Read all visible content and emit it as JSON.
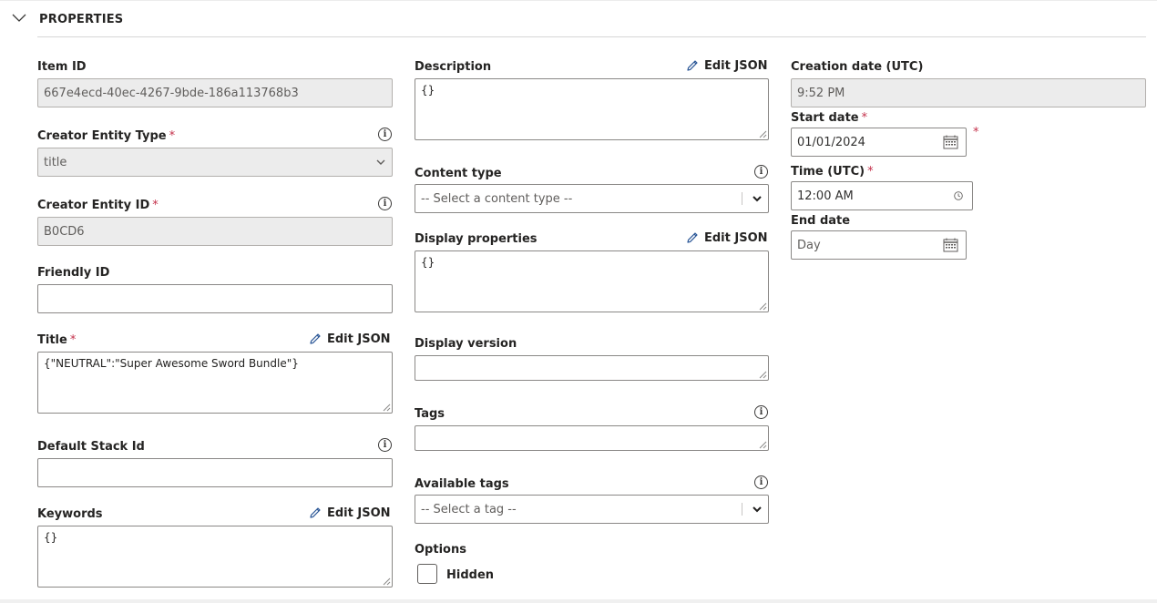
{
  "section": {
    "title": "PROPERTIES"
  },
  "edit_json_label": "Edit JSON",
  "col1": {
    "item_id": {
      "label": "Item ID",
      "value": "667e4ecd-40ec-4267-9bde-186a113768b3"
    },
    "creator_entity_type": {
      "label": "Creator Entity Type",
      "required": "*",
      "value": "title"
    },
    "creator_entity_id": {
      "label": "Creator Entity ID",
      "required": "*",
      "value": "B0CD6"
    },
    "friendly_id": {
      "label": "Friendly ID",
      "value": ""
    },
    "title": {
      "label": "Title",
      "required": "*",
      "value": "{\"NEUTRAL\":\"Super Awesome Sword Bundle\"}"
    },
    "default_stack_id": {
      "label": "Default Stack Id",
      "value": ""
    },
    "keywords": {
      "label": "Keywords",
      "value": "{}"
    }
  },
  "col2": {
    "description": {
      "label": "Description",
      "value": "{}"
    },
    "content_type": {
      "label": "Content type",
      "placeholder": "-- Select a content type --"
    },
    "display_properties": {
      "label": "Display properties",
      "value": "{}"
    },
    "display_version": {
      "label": "Display version",
      "value": ""
    },
    "tags": {
      "label": "Tags",
      "value": ""
    },
    "available_tags": {
      "label": "Available tags",
      "placeholder": "-- Select a tag --"
    },
    "options": {
      "label": "Options",
      "hidden_label": "Hidden",
      "hidden_checked": false
    }
  },
  "col3": {
    "creation_date": {
      "label": "Creation date (UTC)",
      "value": "9:52 PM"
    },
    "start_date": {
      "label": "Start date",
      "required": "*",
      "value": "01/01/2024"
    },
    "time": {
      "label": "Time (UTC)",
      "required": "*",
      "value": "12:00 AM"
    },
    "end_date": {
      "label": "End date",
      "placeholder": "Day"
    }
  },
  "icons": {
    "collapse": "chevron-down-icon",
    "info": "info-icon",
    "edit": "pencil-icon",
    "calendar": "calendar-icon",
    "clock": "clock-icon",
    "dropdown": "chevron-down-icon"
  },
  "colors": {
    "required": "#c4314b",
    "disabled_bg": "#ececec",
    "border": "#8a8886"
  }
}
